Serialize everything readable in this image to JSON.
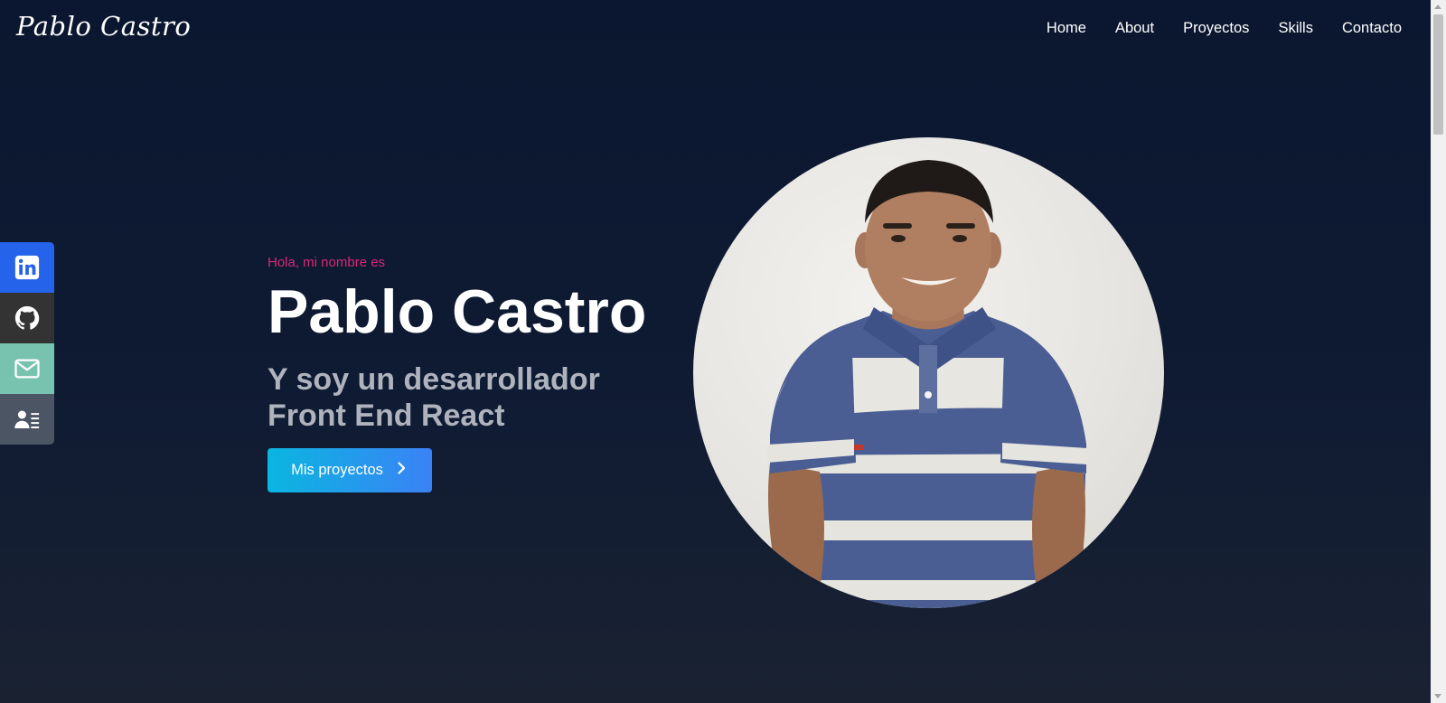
{
  "header": {
    "logo": "Pablo Castro",
    "nav": [
      "Home",
      "About",
      "Proyectos",
      "Skills",
      "Contacto"
    ]
  },
  "social": [
    {
      "name": "linkedin",
      "icon": "linkedin-icon",
      "color": "#2563eb"
    },
    {
      "name": "github",
      "icon": "github-icon",
      "color": "#333333"
    },
    {
      "name": "email",
      "icon": "mail-icon",
      "color": "#78c2b0"
    },
    {
      "name": "resume",
      "icon": "resume-icon",
      "color": "#4b5563"
    }
  ],
  "hero": {
    "greeting": "Hola, mi nombre es",
    "name": "Pablo Castro",
    "role_line1": "Y soy un desarrollador",
    "role_line2": "Front End React",
    "cta_label": "Mis proyectos",
    "cta_icon": "chevron-right-icon"
  },
  "colors": {
    "background": "#0b1730",
    "accent_pink": "#db2777",
    "button_start": "#0ab6e0",
    "button_end": "#3b82f6",
    "role_gray": "#aeb3bd"
  }
}
